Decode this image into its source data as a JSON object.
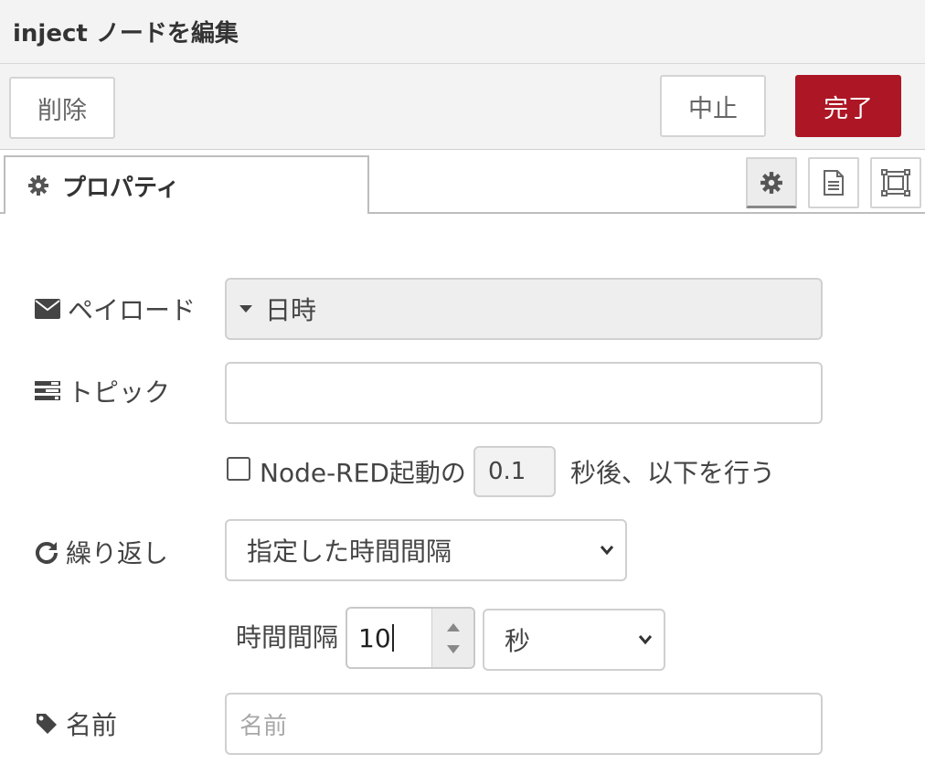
{
  "header": {
    "title": "inject ノードを編集"
  },
  "toolbar": {
    "delete_label": "削除",
    "cancel_label": "中止",
    "done_label": "完了",
    "done_color": "#ad1625"
  },
  "tabs": {
    "properties_label": "プロパティ"
  },
  "form": {
    "payload": {
      "label": "ペイロード",
      "value": "日時"
    },
    "topic": {
      "label": "トピック",
      "value": ""
    },
    "startup": {
      "checkbox_label": "Node-RED起動の",
      "delay_value": "0.1",
      "after_label": "秒後、以下を行う",
      "checked": false
    },
    "repeat": {
      "label": "繰り返し",
      "value": "指定した時間間隔"
    },
    "interval": {
      "label": "時間間隔",
      "value": "10",
      "unit": "秒"
    },
    "name": {
      "label": "名前",
      "placeholder": "名前",
      "value": ""
    }
  }
}
